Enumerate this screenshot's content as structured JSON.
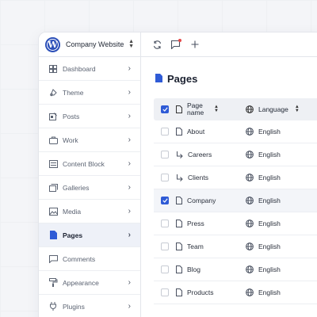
{
  "site": {
    "name": "Company Website"
  },
  "sidebar": {
    "items": [
      {
        "label": "Dashboard",
        "icon": "dashboard-icon"
      },
      {
        "label": "Theme",
        "icon": "theme-icon"
      },
      {
        "label": "Posts",
        "icon": "posts-icon"
      },
      {
        "label": "Work",
        "icon": "briefcase-icon"
      },
      {
        "label": "Content Block",
        "icon": "content-block-icon"
      },
      {
        "label": "Galleries",
        "icon": "galleries-icon"
      },
      {
        "label": "Media",
        "icon": "media-icon"
      },
      {
        "label": "Pages",
        "icon": "pages-icon",
        "active": true
      },
      {
        "label": "Comments",
        "icon": "comment-icon"
      },
      {
        "label": "Appearance",
        "icon": "paint-roller-icon"
      },
      {
        "label": "Plugins",
        "icon": "plug-icon"
      }
    ]
  },
  "main": {
    "title": "Pages",
    "table": {
      "headers": {
        "name": "Page name",
        "language": "Language"
      },
      "rows": [
        {
          "name": "About",
          "language": "English",
          "child": false,
          "checked": false
        },
        {
          "name": "Careers",
          "language": "English",
          "child": true,
          "checked": false
        },
        {
          "name": "Clients",
          "language": "English",
          "child": true,
          "checked": false
        },
        {
          "name": "Company",
          "language": "English",
          "child": false,
          "checked": true
        },
        {
          "name": "Press",
          "language": "English",
          "child": false,
          "checked": false
        },
        {
          "name": "Team",
          "language": "English",
          "child": false,
          "checked": false
        },
        {
          "name": "Blog",
          "language": "English",
          "child": false,
          "checked": false
        },
        {
          "name": "Products",
          "language": "English",
          "child": false,
          "checked": false
        }
      ]
    }
  },
  "colors": {
    "accent": "#2f5bd6",
    "notification": "#e54848"
  }
}
